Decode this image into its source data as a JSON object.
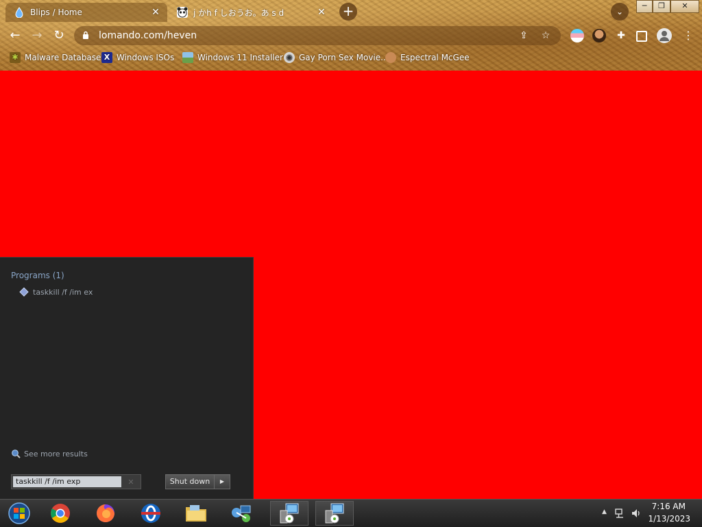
{
  "tabs": [
    {
      "title": "Blips / Home",
      "favicon": "drop-icon",
      "active": true
    },
    {
      "title": "j かh f しおうお。あ s d",
      "favicon": "panda-icon",
      "active": false
    }
  ],
  "address": {
    "url": "lomando.com/heven"
  },
  "bookmarks": [
    {
      "label": "Malware Database",
      "icon": "virus-icon"
    },
    {
      "label": "Windows ISOs",
      "icon": "x-logo-icon"
    },
    {
      "label": "Windows 11 Installer",
      "icon": "image-icon"
    },
    {
      "label": "Gay Porn Sex Movie...",
      "icon": "disk-icon"
    },
    {
      "label": "Espectral McGee",
      "icon": "face-icon"
    }
  ],
  "start_menu": {
    "programs_header": "Programs (1)",
    "program_item": "taskkill /f /im ex",
    "see_more": "See more results",
    "search_value": "taskkill /f /im exp",
    "shutdown_label": "Shut down"
  },
  "taskbar": {
    "apps": [
      "start-orb-icon",
      "chrome-icon",
      "firefox-icon",
      "opera-icon",
      "file-explorer-icon",
      "network-icon",
      "setup-icon",
      "setup-icon"
    ],
    "time": "7:16 AM",
    "date": "1/13/2023"
  },
  "colors": {
    "page_background": "#ff0000",
    "start_menu_bg": "#242424",
    "taskbar_bg": "#2a2a2a"
  }
}
